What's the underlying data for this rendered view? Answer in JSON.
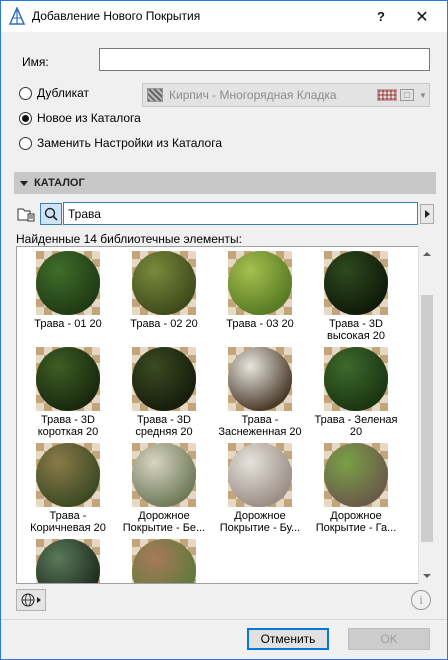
{
  "window": {
    "title": "Добавление Нового Покрытия",
    "help_label": "?",
    "close_label": "✕"
  },
  "name_field": {
    "label": "Имя:",
    "value": ""
  },
  "options": {
    "duplicate_label": "Дубликат",
    "new_from_catalog_label": "Новое из Каталога",
    "replace_settings_label": "Заменить Настройки из Каталога",
    "selected": "new_from_catalog"
  },
  "duplicate_combo": {
    "value": "Кирпич - Многорядная Кладка"
  },
  "catalog": {
    "header": "КАТАЛОГ",
    "search_value": "Трава",
    "found_text": "Найденные 14 библиотечные элементы:"
  },
  "items": [
    {
      "label": "Трава - 01 20",
      "color_a": "#3f6e2a",
      "color_b": "#1f3a14"
    },
    {
      "label": "Трава - 02 20",
      "color_a": "#7a8a3c",
      "color_b": "#3f4a1c"
    },
    {
      "label": "Трава - 03 20",
      "color_a": "#a6c04e",
      "color_b": "#577a23"
    },
    {
      "label": "Трава - 3D\nвысокая 20",
      "color_a": "#2d4a1e",
      "color_b": "#0f1a0a"
    },
    {
      "label": "Трава - 3D\nкороткая 20",
      "color_a": "#3e5e24",
      "color_b": "#18280e"
    },
    {
      "label": "Трава - 3D\nсредняя 20",
      "color_a": "#3a4a22",
      "color_b": "#161d0c"
    },
    {
      "label": "Трава -\nЗаснеженная 20",
      "color_a": "#e8e6e0",
      "color_b": "#4a3a2a"
    },
    {
      "label": "Трава - Зеленая\n20",
      "color_a": "#3d6a2c",
      "color_b": "#1a3512"
    },
    {
      "label": "Трава -\nКоричневая 20",
      "color_a": "#8a7a4a",
      "color_b": "#3c4a22"
    },
    {
      "label": "Дорожное\nПокрытие - Бе...",
      "color_a": "#d8d4c2",
      "color_b": "#6d7a58"
    },
    {
      "label": "Дорожное\nПокрытие - Бу...",
      "color_a": "#e6e2dc",
      "color_b": "#9a8e86"
    },
    {
      "label": "Дорожное\nПокрытие - Га...",
      "color_a": "#7aa046",
      "color_b": "#6a5a4a"
    },
    {
      "label": "",
      "color_a": "#5a7a5a",
      "color_b": "#1e2a1e"
    },
    {
      "label": "",
      "color_a": "#a87a5a",
      "color_b": "#5e7a3a"
    }
  ],
  "buttons": {
    "cancel": "Отменить",
    "ok": "OK"
  },
  "colors": {
    "accent": "#0078d7",
    "section_header": "#c8c8c8"
  }
}
